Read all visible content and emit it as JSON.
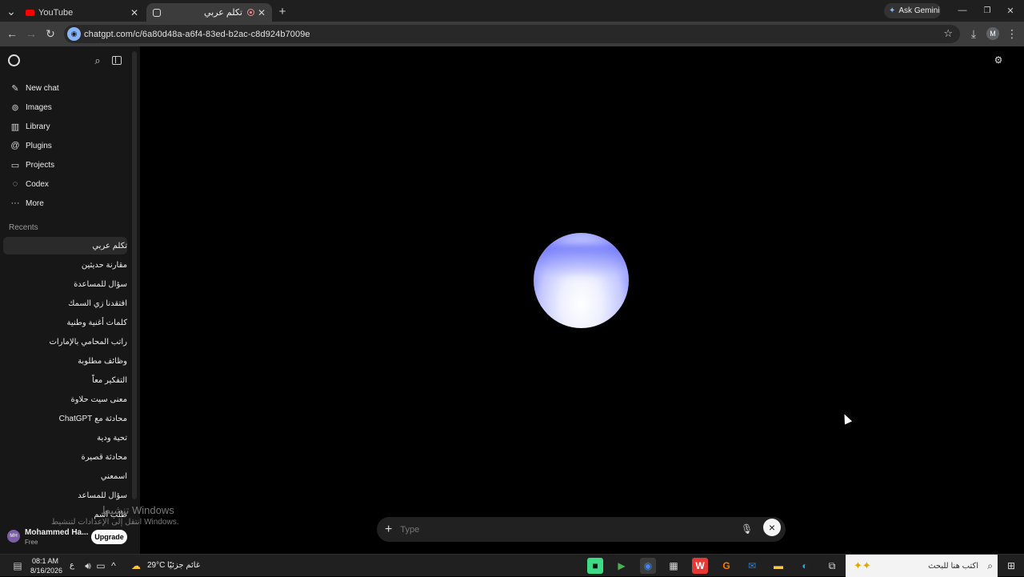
{
  "browser": {
    "tabs": [
      {
        "title": "YouTube"
      },
      {
        "title": "تكلم عربي"
      }
    ],
    "new_tab_symbol": "+",
    "ask_gemini": "Ask Gemini",
    "url": "chatgpt.com/c/6a80d48a-a6f4-83ed-b2ac-c8d924b7009e",
    "profile_initial": "M"
  },
  "sidebar": {
    "nav": [
      {
        "label": "New chat",
        "icon": "new-chat-icon"
      },
      {
        "label": "Images",
        "icon": "images-icon"
      },
      {
        "label": "Library",
        "icon": "library-icon"
      },
      {
        "label": "Plugins",
        "icon": "plugins-icon"
      },
      {
        "label": "Projects",
        "icon": "projects-icon"
      },
      {
        "label": "Codex",
        "icon": "codex-icon"
      },
      {
        "label": "More",
        "icon": "more-icon"
      }
    ],
    "recents_heading": "Recents",
    "recents": [
      "تكلم عربي",
      "مقارنة حديثين",
      "سؤال للمساعدة",
      "افتقدنا زي السمك",
      "كلمات أغنية وطنية",
      "راتب المحامي بالإمارات",
      "وظائف مطلوبة",
      "التفكير معاً",
      "معنى سيت حلاوة",
      "محادثة مع ChatGPT",
      "تحية ودية",
      "محادثة قصيرة",
      "اسمعني",
      "سؤال للمساعد",
      "طلب اسم"
    ],
    "user": {
      "initials": "MH",
      "name": "Mohammed Ha...",
      "plan": "Free",
      "upgrade": "Upgrade"
    }
  },
  "main": {
    "input_placeholder": "Type",
    "plus": "+",
    "close": "×"
  },
  "watermark": {
    "title": "تنشيط Windows",
    "subtitle": "انتقل إلى الإعدادات لتنشيط Windows."
  },
  "taskbar": {
    "time": "08:1 AM",
    "date": "8/16/2026",
    "lang": "ع",
    "weather_temp": "29°C",
    "weather_text": "غائم جزئيًا",
    "search_placeholder": "اكتب هنا للبحث"
  },
  "colors": {
    "sidebar_bg": "#171717",
    "main_bg": "#000000",
    "orb_blue": "#7a80f5",
    "upgrade_bg": "#ffffff"
  }
}
